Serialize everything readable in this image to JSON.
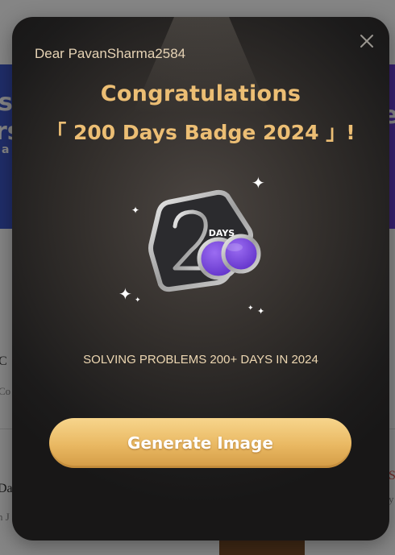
{
  "modal": {
    "greeting": "Dear PavanSharma2584",
    "congrats": "Congratulations",
    "badge_title": "「 200 Days Badge 2024 」!",
    "badge": {
      "top_label": "DAYS"
    },
    "subtitle": "SOLVING PROBLEMS 200+ DAYS IN 2024",
    "button_label": "Generate Image",
    "close_icon": "close-icon"
  },
  "background": {
    "banner_left_1": "s",
    "banner_left_2": "rs",
    "banner_left_3": "a",
    "banner_right": "e",
    "row1_left": "C",
    "row1_left_sub": "Co",
    "row2_left": "Da",
    "row2_left_sub": "n J",
    "row2_right": "S",
    "row2_right_sub": "y"
  },
  "colors": {
    "accent_gold": "#ecbe74",
    "badge_purple": "#7b4ae0",
    "modal_dark": "#1c1b1b"
  }
}
